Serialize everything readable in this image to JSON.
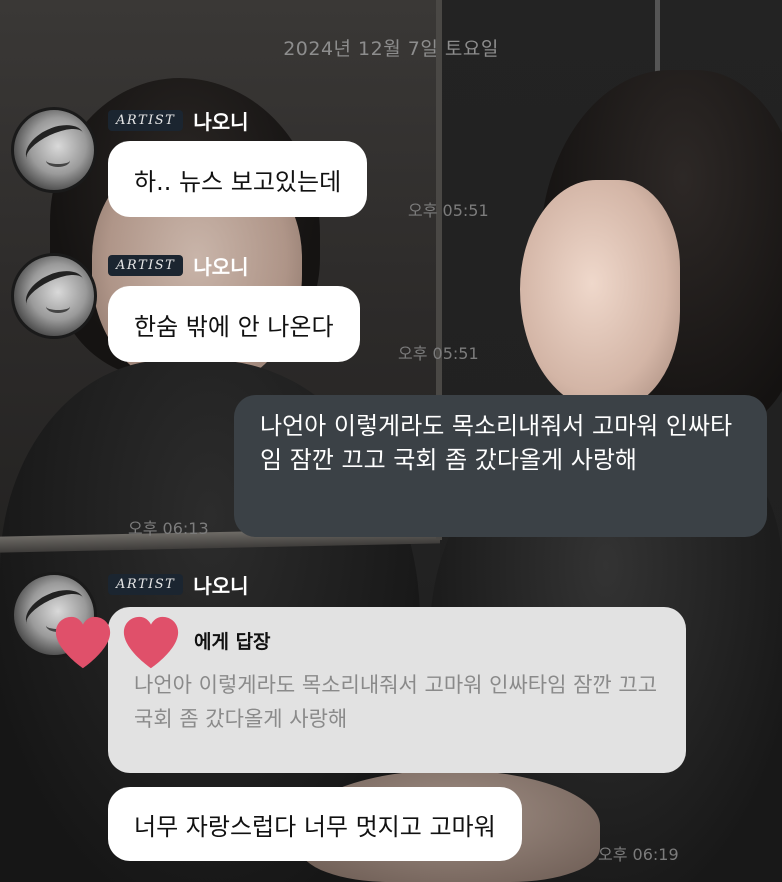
{
  "chat": {
    "date": "2024년 12월 7일 토요일",
    "messages": [
      {
        "badge": "ARTIST",
        "sender": "나오니",
        "text": "하.. 뉴스 보고있는데",
        "time": "오후 05:51"
      },
      {
        "badge": "ARTIST",
        "sender": "나오니",
        "text": "한숨 밖에 안 나온다",
        "time": "오후 05:51"
      },
      {
        "text": "나언아 이렇게라도 목소리내줘서 고마워 인싸타임 잠깐 끄고 국회 좀 갔다올게 사랑해",
        "time": "오후 06:13"
      },
      {
        "badge": "ARTIST",
        "sender": "나오니",
        "reply_header": "에게 답장",
        "reply_quote": "나언아 이렇게라도 목소리내줘서 고마워 인싸타임 잠깐 끄고 국회 좀 갔다올게 사랑해",
        "text": "너무 자랑스럽다 너무 멋지고 고마워",
        "time": "오후 06:19"
      }
    ]
  },
  "colors": {
    "incoming_bubble": "#ffffff",
    "outgoing_bubble": "#3b4146",
    "reply_bubble": "#e2e2e2",
    "heart": "#e0506a",
    "artist_badge": "#1b2530"
  },
  "icons": [
    "heart-icon",
    "heart-icon"
  ]
}
